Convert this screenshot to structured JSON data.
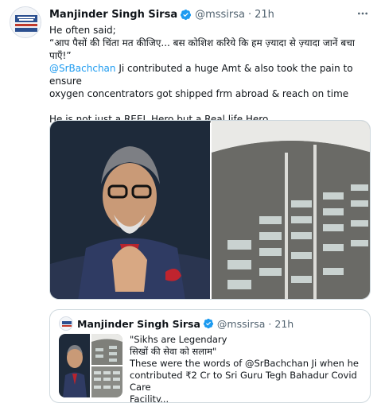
{
  "tweet": {
    "author_name": "Manjinder Singh Sirsa",
    "handle": "@mssirsa",
    "time": "21h",
    "separator": "·",
    "lines": [
      "He often said;",
      "“आप पैसों की चिंता मत कीजिए... बस कोशिश करिये कि हम ज़्यादा से ज़्यादा जानें बचा",
      "पाएँ!”"
    ],
    "mention": "@SrBachchan",
    "line_after_mention": " Ji contributed a huge Amt & also took the pain to ensure",
    "line_cont": "oxygen concentrators got shipped frm abroad & reach on time",
    "closing": "He is not just a REEL Hero but a Real life Hero",
    "icons": {
      "verified": "verified-badge-icon",
      "more": "more-options-icon"
    }
  },
  "quote": {
    "author_name": "Manjinder Singh Sirsa",
    "handle": "@mssirsa",
    "time": "21h",
    "separator": "·",
    "lines": [
      "\"Sikhs are Legendary",
      "सिखों की सेवा को सलाम\"",
      "These were the words of @SrBachchan Ji when he",
      "contributed ₹2 Cr to Sri Guru Tegh Bahadur Covid Care",
      "Facility..."
    ]
  },
  "colors": {
    "link": "#1d9bf0",
    "verified": "#1d9bf0",
    "secondary_text": "#536471",
    "border": "#cfd9de"
  }
}
